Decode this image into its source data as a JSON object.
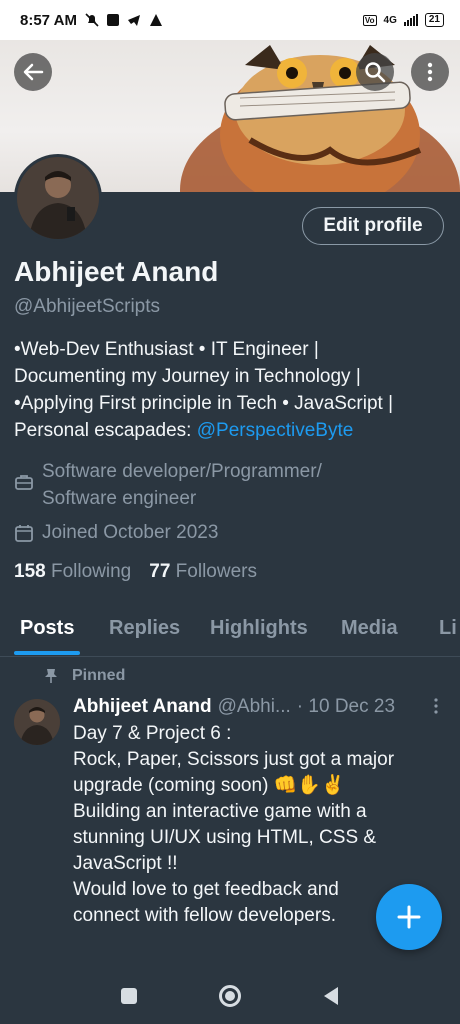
{
  "status_bar": {
    "time": "8:57 AM",
    "network": "4G",
    "battery": "21"
  },
  "banner": {
    "back_icon": "arrow-left-icon",
    "search_icon": "search-icon",
    "more_icon": "more-vertical-icon"
  },
  "profile": {
    "edit_label": "Edit profile",
    "name": "Abhijeet Anand",
    "handle": "@AbhijeetScripts",
    "bio_lines": [
      "•Web-Dev Enthusiast • IT Engineer |",
      "Documenting my Journey in Technology |",
      "•Applying First principle in Tech • JavaScript |"
    ],
    "bio_last_prefix": "Personal escapades: ",
    "bio_link": "@PerspectiveByte",
    "profession_line1": "Software developer/Programmer/",
    "profession_line2": "Software engineer",
    "joined": "Joined October 2023",
    "following_count": "158",
    "following_label": "Following",
    "followers_count": "77",
    "followers_label": "Followers"
  },
  "tabs": [
    {
      "label": "Posts",
      "active": true
    },
    {
      "label": "Replies",
      "active": false
    },
    {
      "label": "Highlights",
      "active": false
    },
    {
      "label": "Media",
      "active": false
    },
    {
      "label": "Li",
      "active": false
    }
  ],
  "pinned_post": {
    "pinned_label": "Pinned",
    "author": "Abhijeet Anand",
    "handle": "@Abhi...",
    "date": "· 10 Dec 23",
    "lines": [
      "Day 7 & Project 6 :",
      "Rock, Paper, Scissors just got a major",
      "upgrade (coming soon) 👊✋✌️",
      "Building an interactive game with a",
      "stunning UI/UX using HTML, CSS  &",
      "JavaScript !!",
      "Would love to get feedback and",
      "connect with fellow developers."
    ]
  },
  "colors": {
    "background": "#2b3640",
    "accent": "#1d9bf0",
    "muted": "#8b98a5"
  }
}
